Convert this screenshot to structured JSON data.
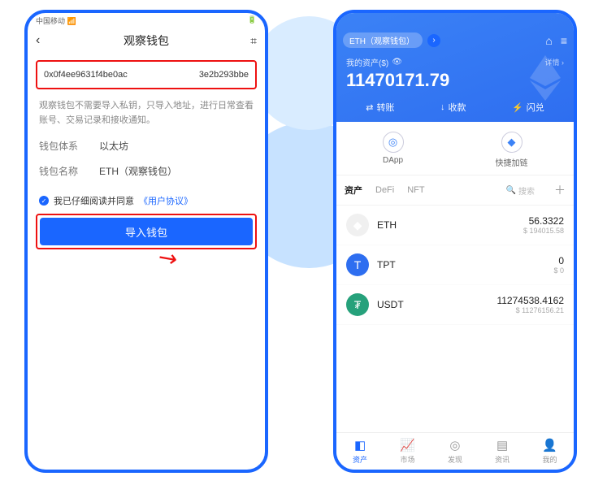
{
  "left": {
    "status_left": "中国移动 📶",
    "status_right": "🔋",
    "title": "观察钱包",
    "back": "‹",
    "scan": "⌗",
    "addr_part1": "0x0f4ee9631f4be0ac",
    "addr_part2": "3e2b293bbe",
    "desc": "观察钱包不需要导入私钥，只导入地址，进行日常查看账号、交易记录和接收通知。",
    "chain_label": "钱包体系",
    "chain_value": "以太坊",
    "name_label": "钱包名称",
    "name_value": "ETH（观察钱包）",
    "agree_text": "我已仔细阅读并同意",
    "agree_link": "《用户协议》",
    "import_btn": "导入钱包"
  },
  "right": {
    "chain_chip": "ETH（观察钱包）",
    "asset_label": "我的资产($)",
    "details": "详情 ›",
    "balance": "11470171.79",
    "actions": {
      "transfer": "转账",
      "receive": "收款",
      "swap": "闪兑"
    },
    "mid": {
      "dapp": "DApp",
      "quick": "快捷加链"
    },
    "tabs": {
      "assets": "资产",
      "defi": "DeFi",
      "nft": "NFT",
      "search": "搜索"
    },
    "tokens": [
      {
        "symbol": "ETH",
        "balance": "56.3322",
        "fiat": "$ 194015.58"
      },
      {
        "symbol": "TPT",
        "balance": "0",
        "fiat": "$ 0"
      },
      {
        "symbol": "USDT",
        "balance": "11274538.4162",
        "fiat": "$ 11276156.21"
      }
    ],
    "bottom": {
      "assets": "资产",
      "market": "市场",
      "discover": "发现",
      "news": "资讯",
      "me": "我的"
    }
  }
}
